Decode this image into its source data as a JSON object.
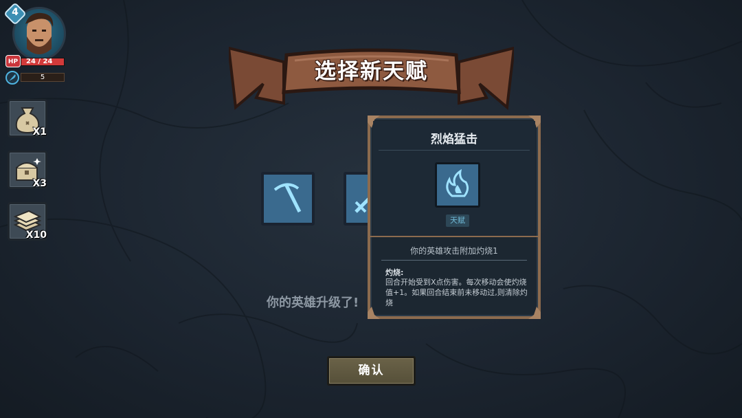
{
  "hud": {
    "level": "4",
    "hp_label": "HP",
    "hp_text": "24 / 24",
    "hp_fraction": 1.0,
    "mana_value": "5"
  },
  "inventory": [
    {
      "item": "loot-bag-icon",
      "count": "X1"
    },
    {
      "item": "treasure-chest-icon",
      "count": "X3"
    },
    {
      "item": "parchment-stack-icon",
      "count": "X10"
    }
  ],
  "banner": {
    "title": "选择新天赋"
  },
  "talents": [
    {
      "icon": "pickaxe-icon"
    },
    {
      "icon": "sword-icon"
    }
  ],
  "levelup_text": "你的英雄升级了!",
  "tooltip": {
    "title": "烈焰猛击",
    "icon": "blue-flame-icon",
    "tag": "天赋",
    "description": "你的英雄攻击附加灼烧1",
    "keyword_title": "灼烧:",
    "keyword_text": "回合开始受到X点伤害。每次移动会使灼烧值+1。如果回合结束前未移动过,则清除灼烧"
  },
  "confirm_label": "确认",
  "colors": {
    "accent_blue": "#4fb3e0",
    "frame_brown": "#8c6b4e",
    "hp_red": "#d23a3a"
  }
}
